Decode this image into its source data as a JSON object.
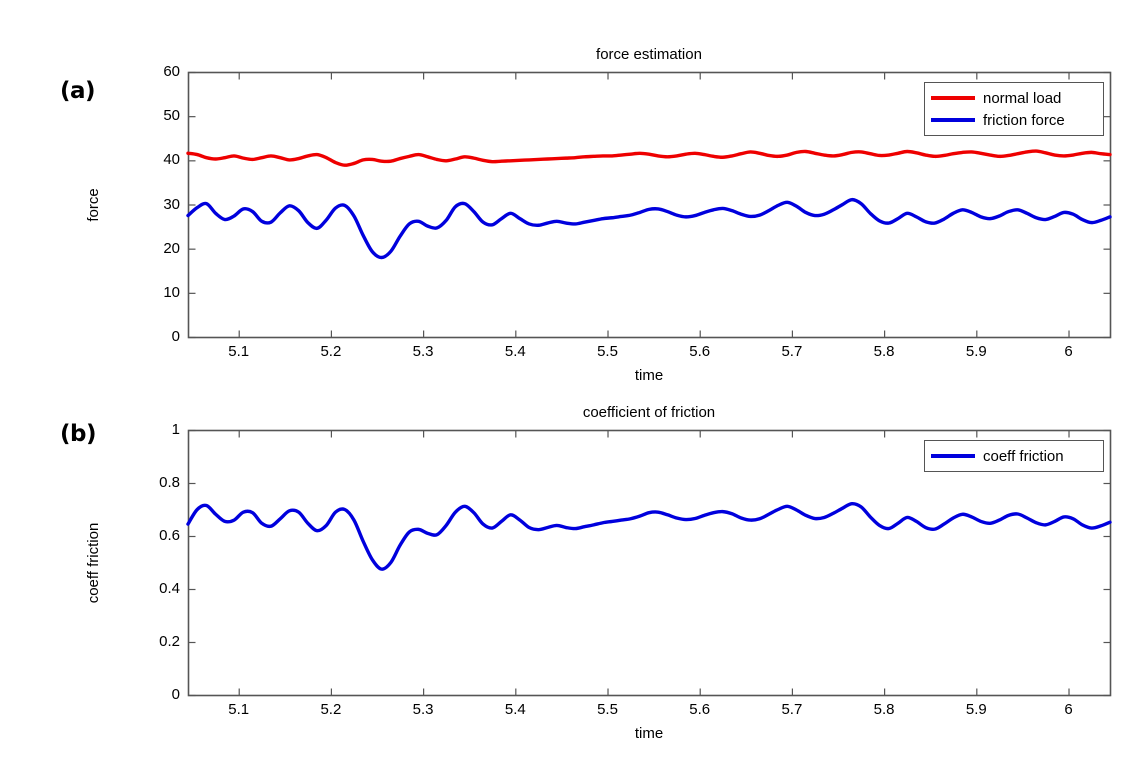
{
  "figure": {
    "panels": [
      {
        "tag": "(a)"
      },
      {
        "tag": "(b)"
      }
    ]
  },
  "colors": {
    "normal_load": "#ee0000",
    "friction_force": "#0000dd",
    "coeff_friction": "#0000dd",
    "axis": "#555555",
    "text": "#000000",
    "background": "#ffffff"
  },
  "chart_data": [
    {
      "type": "line",
      "panel": "(a)",
      "title": "force estimation",
      "xlabel": "time",
      "ylabel": "force",
      "xlim": [
        5.045,
        6.045
      ],
      "ylim": [
        0,
        60
      ],
      "xticks": [
        "5.1",
        "5.2",
        "5.3",
        "5.4",
        "5.5",
        "5.6",
        "5.7",
        "5.8",
        "5.9",
        "6"
      ],
      "xtick_values": [
        5.1,
        5.2,
        5.3,
        5.4,
        5.5,
        5.6,
        5.7,
        5.8,
        5.9,
        6.0
      ],
      "yticks": [
        "0",
        "10",
        "20",
        "30",
        "40",
        "50",
        "60"
      ],
      "ytick_values": [
        0,
        10,
        20,
        30,
        40,
        50,
        60
      ],
      "grid": false,
      "legend_position": "top-right",
      "legend": [
        "normal load",
        "friction force"
      ],
      "x": [
        5.045,
        5.055,
        5.065,
        5.075,
        5.085,
        5.095,
        5.105,
        5.115,
        5.125,
        5.135,
        5.145,
        5.155,
        5.165,
        5.175,
        5.185,
        5.195,
        5.205,
        5.215,
        5.225,
        5.235,
        5.245,
        5.255,
        5.265,
        5.275,
        5.285,
        5.295,
        5.305,
        5.315,
        5.325,
        5.335,
        5.345,
        5.355,
        5.365,
        5.375,
        5.385,
        5.395,
        5.405,
        5.415,
        5.425,
        5.435,
        5.445,
        5.455,
        5.465,
        5.475,
        5.485,
        5.495,
        5.505,
        5.515,
        5.525,
        5.535,
        5.545,
        5.555,
        5.565,
        5.575,
        5.585,
        5.595,
        5.605,
        5.615,
        5.625,
        5.635,
        5.645,
        5.655,
        5.665,
        5.675,
        5.685,
        5.695,
        5.705,
        5.715,
        5.725,
        5.735,
        5.745,
        5.755,
        5.765,
        5.775,
        5.785,
        5.795,
        5.805,
        5.815,
        5.825,
        5.835,
        5.845,
        5.855,
        5.865,
        5.875,
        5.885,
        5.895,
        5.905,
        5.915,
        5.925,
        5.935,
        5.945,
        5.955,
        5.965,
        5.975,
        5.985,
        5.995,
        6.005,
        6.015,
        6.025,
        6.035,
        6.045
      ],
      "series": [
        {
          "name": "normal load",
          "color": "#ee0000",
          "values": [
            41.6,
            41.3,
            40.6,
            40.3,
            40.6,
            41.0,
            40.5,
            40.2,
            40.6,
            41.0,
            40.6,
            40.1,
            40.4,
            41.0,
            41.3,
            40.6,
            39.5,
            38.9,
            39.3,
            40.1,
            40.2,
            39.8,
            39.8,
            40.4,
            40.9,
            41.3,
            40.8,
            40.2,
            39.9,
            40.3,
            40.8,
            40.5,
            40.0,
            39.7,
            39.8,
            39.9,
            40.0,
            40.1,
            40.2,
            40.3,
            40.4,
            40.5,
            40.6,
            40.8,
            40.9,
            41.0,
            41.0,
            41.2,
            41.4,
            41.6,
            41.4,
            41.0,
            40.8,
            41.0,
            41.4,
            41.6,
            41.3,
            40.9,
            40.7,
            41.0,
            41.5,
            41.9,
            41.6,
            41.1,
            40.9,
            41.2,
            41.8,
            42.0,
            41.6,
            41.2,
            41.0,
            41.3,
            41.8,
            41.9,
            41.5,
            41.1,
            41.2,
            41.6,
            42.0,
            41.7,
            41.2,
            40.9,
            41.1,
            41.5,
            41.8,
            41.9,
            41.6,
            41.2,
            40.9,
            41.1,
            41.5,
            41.9,
            42.1,
            41.7,
            41.2,
            41.0,
            41.2,
            41.6,
            41.8,
            41.5,
            41.3
          ]
        },
        {
          "name": "friction force",
          "color": "#0000dd",
          "values": [
            27.5,
            29.3,
            30.2,
            28.0,
            26.6,
            27.4,
            29.0,
            28.4,
            26.2,
            26.0,
            28.1,
            29.7,
            28.6,
            25.9,
            24.6,
            26.5,
            29.2,
            29.8,
            27.4,
            23.0,
            19.3,
            18.0,
            19.4,
            22.8,
            25.6,
            26.2,
            25.1,
            24.7,
            26.4,
            29.5,
            30.2,
            28.4,
            26.0,
            25.4,
            26.8,
            28.0,
            26.8,
            25.6,
            25.3,
            25.8,
            26.2,
            25.8,
            25.6,
            26.0,
            26.4,
            26.8,
            27.0,
            27.3,
            27.6,
            28.2,
            28.9,
            29.0,
            28.4,
            27.6,
            27.2,
            27.5,
            28.2,
            28.8,
            29.1,
            28.6,
            27.8,
            27.3,
            27.6,
            28.6,
            29.8,
            30.5,
            29.6,
            28.2,
            27.5,
            27.8,
            28.8,
            30.0,
            31.1,
            30.2,
            28.0,
            26.3,
            25.8,
            26.8,
            28.0,
            27.2,
            26.1,
            25.8,
            26.7,
            28.0,
            28.8,
            28.2,
            27.2,
            26.8,
            27.4,
            28.4,
            28.8,
            28.0,
            27.0,
            26.6,
            27.3,
            28.2,
            27.8,
            26.6,
            25.9,
            26.4,
            27.2
          ]
        }
      ]
    },
    {
      "type": "line",
      "panel": "(b)",
      "title": "coefficient of friction",
      "xlabel": "time",
      "ylabel": "coeff friction",
      "xlim": [
        5.045,
        6.045
      ],
      "ylim": [
        0,
        1
      ],
      "xticks": [
        "5.1",
        "5.2",
        "5.3",
        "5.4",
        "5.5",
        "5.6",
        "5.7",
        "5.8",
        "5.9",
        "6"
      ],
      "xtick_values": [
        5.1,
        5.2,
        5.3,
        5.4,
        5.5,
        5.6,
        5.7,
        5.8,
        5.9,
        6.0
      ],
      "yticks": [
        "0",
        "0.2",
        "0.4",
        "0.6",
        "0.8",
        "1"
      ],
      "ytick_values": [
        0,
        0.2,
        0.4,
        0.6,
        0.8,
        1.0
      ],
      "grid": false,
      "legend_position": "top-right",
      "legend": [
        "coeff friction"
      ],
      "x": [
        5.045,
        5.055,
        5.065,
        5.075,
        5.085,
        5.095,
        5.105,
        5.115,
        5.125,
        5.135,
        5.145,
        5.155,
        5.165,
        5.175,
        5.185,
        5.195,
        5.205,
        5.215,
        5.225,
        5.235,
        5.245,
        5.255,
        5.265,
        5.275,
        5.285,
        5.295,
        5.305,
        5.315,
        5.325,
        5.335,
        5.345,
        5.355,
        5.365,
        5.375,
        5.385,
        5.395,
        5.405,
        5.415,
        5.425,
        5.435,
        5.445,
        5.455,
        5.465,
        5.475,
        5.485,
        5.495,
        5.505,
        5.515,
        5.525,
        5.535,
        5.545,
        5.555,
        5.565,
        5.575,
        5.585,
        5.595,
        5.605,
        5.615,
        5.625,
        5.635,
        5.645,
        5.655,
        5.665,
        5.675,
        5.685,
        5.695,
        5.705,
        5.715,
        5.725,
        5.735,
        5.745,
        5.755,
        5.765,
        5.775,
        5.785,
        5.795,
        5.805,
        5.815,
        5.825,
        5.835,
        5.845,
        5.855,
        5.865,
        5.875,
        5.885,
        5.895,
        5.905,
        5.915,
        5.925,
        5.935,
        5.945,
        5.955,
        5.965,
        5.975,
        5.985,
        5.995,
        6.005,
        6.015,
        6.025,
        6.035,
        6.045
      ],
      "series": [
        {
          "name": "coeff friction",
          "color": "#0000dd",
          "values": [
            0.645,
            0.7,
            0.715,
            0.682,
            0.655,
            0.66,
            0.69,
            0.688,
            0.648,
            0.637,
            0.665,
            0.695,
            0.69,
            0.648,
            0.62,
            0.64,
            0.69,
            0.7,
            0.66,
            0.58,
            0.51,
            0.475,
            0.5,
            0.565,
            0.615,
            0.625,
            0.61,
            0.605,
            0.64,
            0.69,
            0.712,
            0.688,
            0.645,
            0.63,
            0.655,
            0.68,
            0.66,
            0.632,
            0.624,
            0.632,
            0.64,
            0.632,
            0.628,
            0.635,
            0.642,
            0.65,
            0.655,
            0.66,
            0.665,
            0.675,
            0.688,
            0.69,
            0.68,
            0.668,
            0.662,
            0.666,
            0.678,
            0.688,
            0.692,
            0.684,
            0.668,
            0.66,
            0.665,
            0.682,
            0.7,
            0.712,
            0.698,
            0.678,
            0.666,
            0.67,
            0.686,
            0.705,
            0.722,
            0.71,
            0.672,
            0.64,
            0.628,
            0.648,
            0.67,
            0.655,
            0.632,
            0.626,
            0.645,
            0.668,
            0.682,
            0.672,
            0.655,
            0.648,
            0.66,
            0.678,
            0.683,
            0.668,
            0.65,
            0.642,
            0.655,
            0.672,
            0.665,
            0.642,
            0.63,
            0.638,
            0.652
          ]
        }
      ]
    }
  ]
}
